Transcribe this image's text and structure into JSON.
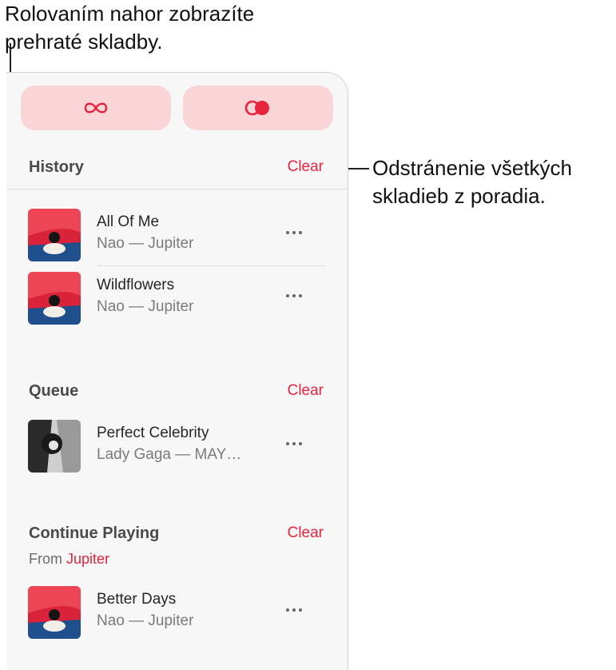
{
  "callouts": {
    "top": [
      "Rolovaním nahor zobrazíte",
      "prehraté skladby."
    ],
    "right": [
      "Odstránenie všetkých",
      "skladieb z poradia."
    ]
  },
  "controls": {
    "infinity_icon": "infinity-icon",
    "autoplay_icon": "autoplay-icon",
    "accent": "#e8243c",
    "pill_bg": "#f9d5d7"
  },
  "history": {
    "title": "History",
    "clear": "Clear",
    "tracks": [
      {
        "title": "All Of Me",
        "subtitle": "Nao — Jupiter",
        "art": "jupiter-album-art"
      },
      {
        "title": "Wildflowers",
        "subtitle": "Nao — Jupiter",
        "art": "jupiter-album-art"
      }
    ]
  },
  "queue": {
    "title": "Queue",
    "clear": "Clear",
    "tracks": [
      {
        "title": "Perfect Celebrity",
        "subtitle": "Lady Gaga — MAY…",
        "art": "mayhem-album-art"
      }
    ]
  },
  "continue_playing": {
    "title": "Continue Playing",
    "clear": "Clear",
    "from_label": "From",
    "from_source": "Jupiter",
    "tracks": [
      {
        "title": "Better Days",
        "subtitle": "Nao — Jupiter",
        "art": "jupiter-album-art"
      }
    ]
  }
}
